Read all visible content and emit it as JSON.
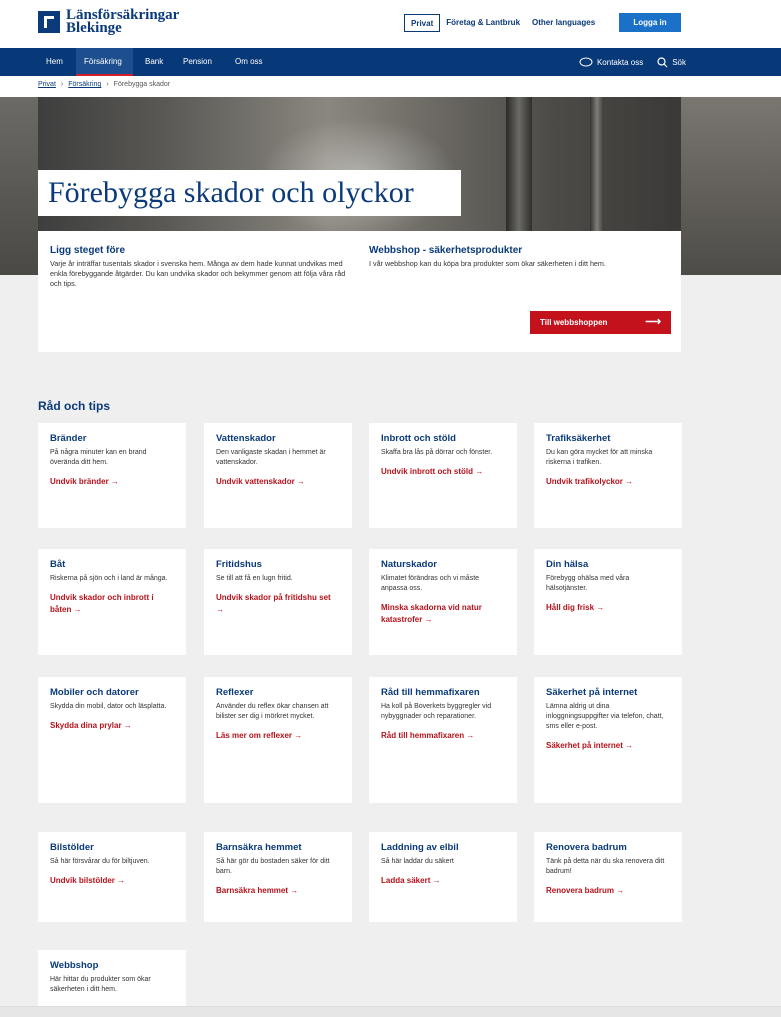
{
  "header": {
    "logo_line1": "Länsförsäkringar",
    "logo_line2": "Blekinge",
    "links": [
      "Privat",
      "Företag & Lantbruk",
      "Other languages"
    ],
    "login": "Logga in"
  },
  "nav": {
    "items": [
      "Hem",
      "Försäkring",
      "Bank",
      "Pension",
      "Om oss"
    ],
    "contact": "Kontakta oss",
    "search": "Sök"
  },
  "breadcrumb": [
    "Privat",
    "Försäkring",
    "Förebygga skador"
  ],
  "hero": {
    "title": "Förebygga skador och olyckor"
  },
  "intro": {
    "left_title": "Ligg steget före",
    "left_text": "Varje år inträffar tusentals skador i svenska hem. Många av dem hade kunnat undvikas med enkla förebyggande åtgärder. Du kan undvika skador och bekymmer genom att följa våra råd och tips.",
    "right_title": "Webbshop - säkerhetsprodukter",
    "right_text": "I vår webbshop kan du köpa bra produkter som ökar säkerheten i ditt hem.",
    "button": "Till webbshoppen"
  },
  "section_title": "Råd och tips",
  "cards": [
    {
      "title": "Bränder",
      "text": "På några minuter kan en brand överända ditt hem.",
      "link": "Undvik bränder →"
    },
    {
      "title": "Vattenskador",
      "text": "Den vanligaste skadan i hemmet är vattenskador.",
      "link": "Undvik vattenskador →"
    },
    {
      "title": "Inbrott och stöld",
      "text": "Skaffa bra lås på dörrar och fönster.",
      "link": "Undvik inbrott och stöld →"
    },
    {
      "title": "Trafiksäkerhet",
      "text": "Du kan göra mycket för att minska riskerna i trafiken.",
      "link": "Undvik trafikolyckor →"
    },
    {
      "title": "Båt",
      "text": "Riskerna på sjön och i land är många.",
      "link": "Undvik skador och inbrott i båten →"
    },
    {
      "title": "Fritidshus",
      "text": "Se till att få en lugn fritid.",
      "link": "Undvik skador på fritidshu set →"
    },
    {
      "title": "Naturskador",
      "text": "Klimatet förändras och vi måste anpassa oss.",
      "link": "Minska skadorna vid natur katastrofer →"
    },
    {
      "title": "Din hälsa",
      "text": "Förebygg ohälsa med våra hälsotjänster.",
      "link": "Håll dig frisk →"
    },
    {
      "title": "Mobiler och datorer",
      "text": "Skydda din mobil, dator och läsplatta.",
      "link": "Skydda dina prylar →"
    },
    {
      "title": "Reflexer",
      "text": "Använder du reflex ökar chansen att bilister ser dig i mörkret mycket.",
      "link": "Läs mer om reflexer →"
    },
    {
      "title": "Råd till hemmafixaren",
      "text": "Ha koll på Boverkets byggregler vid nybyggnader och reparationer.",
      "link": "Råd till hemmafixaren →"
    },
    {
      "title": "Säkerhet på internet",
      "text": "Lämna aldrig ut dina inloggningsuppgifter via telefon, chatt, sms eller e-post.",
      "link": "Säkerhet på internet →"
    },
    {
      "title": "Bilstölder",
      "text": "Så här försvårar du för biltjuven.",
      "link": "Undvik bilstölder →"
    },
    {
      "title": "Barnsäkra hemmet",
      "text": "Så här gör du bostaden säker för ditt barn.",
      "link": "Barnsäkra hemmet →"
    },
    {
      "title": "Laddning av elbil",
      "text": "Så här laddar du säkert",
      "link": "Ladda säkert →"
    },
    {
      "title": "Renovera badrum",
      "text": "Tänk på detta när du ska renovera ditt badrum!",
      "link": "Renovera badrum →"
    },
    {
      "title": "Webbshop",
      "text": "Här hittar du produkter som ökar säkerheten i ditt hem.",
      "link": ""
    }
  ]
}
